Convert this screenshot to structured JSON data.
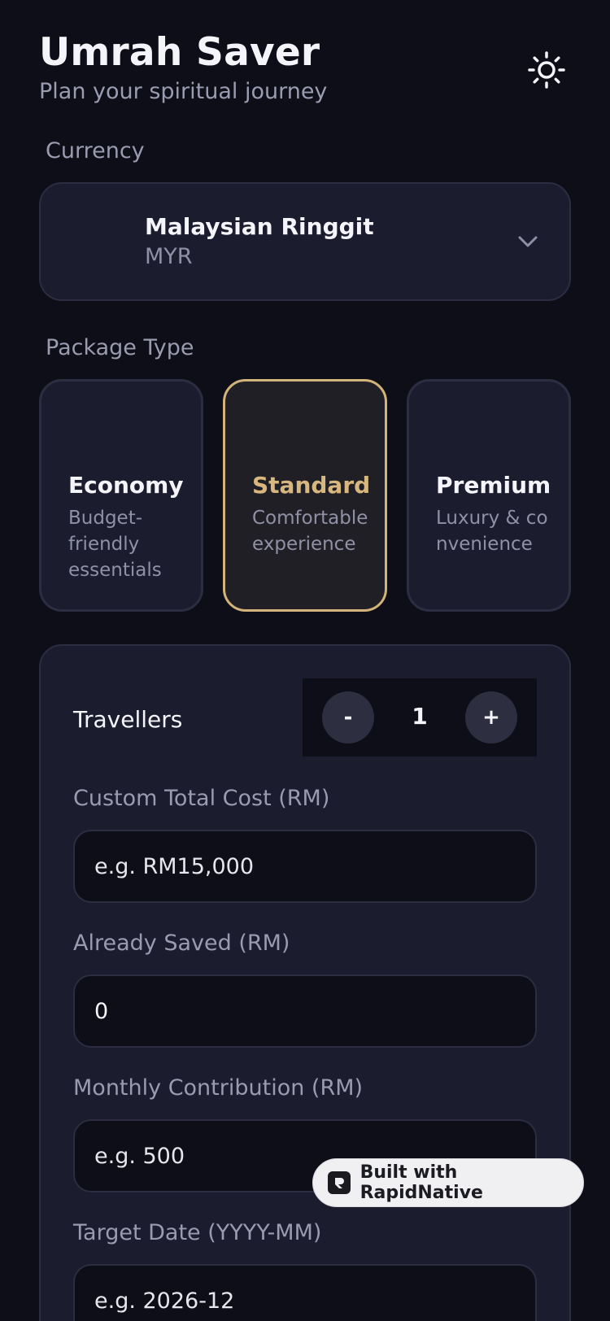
{
  "header": {
    "title": "Umrah Saver",
    "subtitle": "Plan your spiritual journey",
    "theme_icon": "sun-icon"
  },
  "currency": {
    "label": "Currency",
    "name": "Malaysian Ringgit",
    "code": "MYR",
    "icon": "chevron-down-icon"
  },
  "package": {
    "label": "Package Type",
    "selected": "Standard",
    "options": [
      {
        "name": "Economy",
        "description": "Budget-friendly essentials"
      },
      {
        "name": "Standard",
        "description": "Comfortable experience"
      },
      {
        "name": "Premium",
        "description": "Luxury & convenience"
      }
    ]
  },
  "travellers": {
    "label": "Travellers",
    "minus": "-",
    "plus": "+",
    "count": "1"
  },
  "fields": {
    "custom_total": {
      "label": "Custom Total Cost (RM)",
      "placeholder": "e.g. RM15,000",
      "value": ""
    },
    "already_saved": {
      "label": "Already Saved (RM)",
      "placeholder": "",
      "value": "0"
    },
    "monthly": {
      "label": "Monthly Contribution (RM)",
      "placeholder": "e.g. 500",
      "value": ""
    },
    "target_date": {
      "label": "Target Date (YYYY-MM)",
      "placeholder": "e.g. 2026-12",
      "value": ""
    }
  },
  "badge": {
    "text": "Built with RapidNative"
  },
  "colors": {
    "background": "#0d0e17",
    "card": "#1b1c2e",
    "accent": "#d2b47a"
  }
}
